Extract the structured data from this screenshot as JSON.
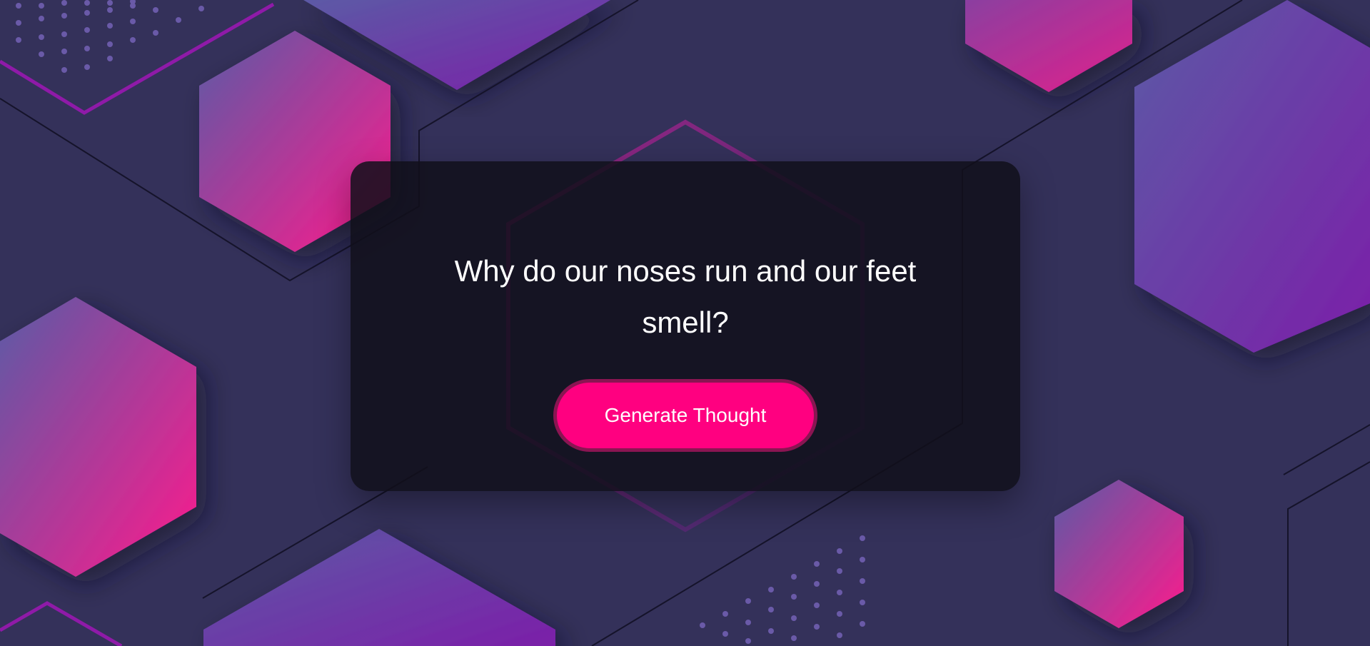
{
  "page": {
    "thought_text": "Why do our noses run and our feet smell?",
    "button_label": "Generate Thought"
  },
  "colors": {
    "background": "#34315a",
    "card": "#100f1a",
    "button": "#ff0080",
    "button_border": "#8a1552",
    "gradient_start": "#5a5ba6",
    "gradient_mid": "#7a2ca8",
    "gradient_pink": "#ff1a8c"
  }
}
